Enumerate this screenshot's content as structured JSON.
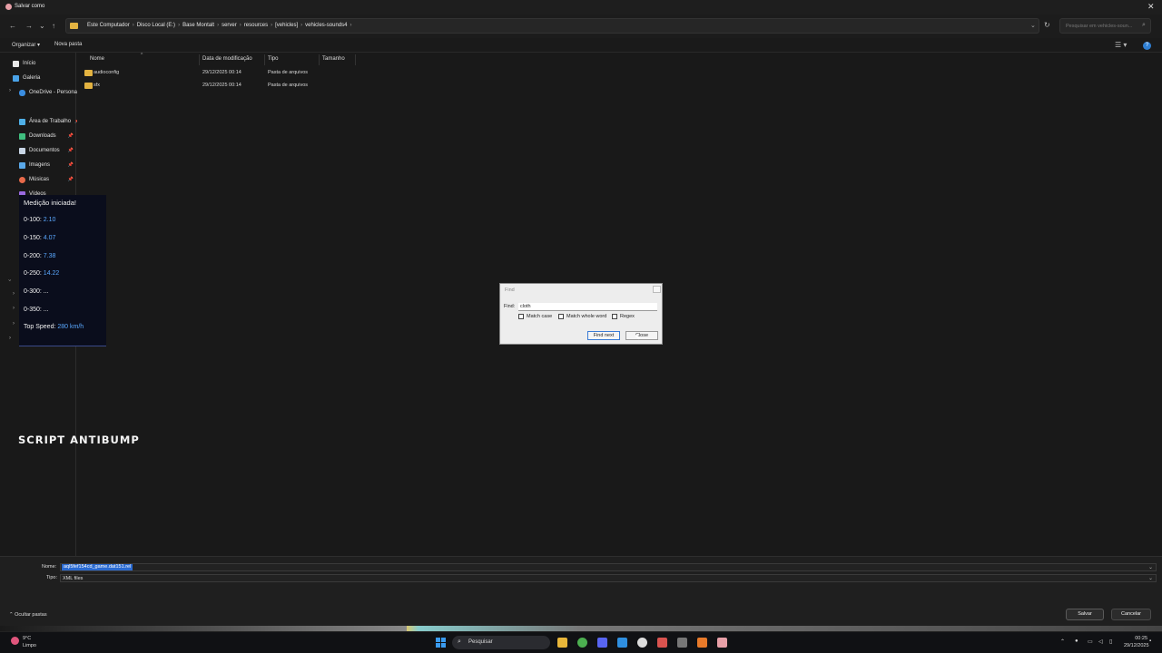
{
  "window": {
    "title": "Salvar como",
    "close_glyph": "✕"
  },
  "nav": {
    "back": "←",
    "forward": "→",
    "recent": "⌄",
    "up": "↑",
    "breadcrumbs": [
      "Este Computador",
      "Disco Local (E:)",
      "Base Montalt",
      "server",
      "resources",
      "[vehicles]",
      "vehicles-sounds4"
    ],
    "separator": "›",
    "refresh": "↻",
    "search_placeholder": "Pesquisar em vehicles-soun...",
    "search_icon": "⌕"
  },
  "commandbar": {
    "organize": "Organizar ▾",
    "new_folder": "Nova pasta",
    "view": "☰ ▾",
    "help": "?"
  },
  "sidebar": {
    "items": [
      {
        "label": "Início",
        "icon": "home-icon",
        "color": "#e8e8e8",
        "pinned": false
      },
      {
        "label": "Galeria",
        "icon": "gallery-icon",
        "color": "#4aa3e8",
        "pinned": false
      },
      {
        "label": "OneDrive - Persona",
        "icon": "cloud-icon",
        "color": "#3a8de0",
        "pinned": false
      },
      {
        "label": "Área de Trabalho",
        "icon": "desktop-icon",
        "color": "#4fb0e8",
        "pinned": true
      },
      {
        "label": "Downloads",
        "icon": "download-icon",
        "color": "#3fbf7f",
        "pinned": true
      },
      {
        "label": "Documentos",
        "icon": "document-icon",
        "color": "#c9d6e6",
        "pinned": true
      },
      {
        "label": "Imagens",
        "icon": "image-icon",
        "color": "#5aa8e8",
        "pinned": true
      },
      {
        "label": "Músicas",
        "icon": "music-icon",
        "color": "#e86a4a",
        "pinned": true
      },
      {
        "label": "Vídeos",
        "icon": "video-icon",
        "color": "#9a6ae0",
        "pinned": false
      }
    ],
    "pin_glyph": "📌",
    "chevron": "›"
  },
  "files": {
    "columns": [
      "Nome",
      "Data de modificação",
      "Tipo",
      "Tamanho"
    ],
    "rows": [
      {
        "name": "audioconfig",
        "date": "29/12/2025 00:14",
        "type": "Pasta de arquivos",
        "size": ""
      },
      {
        "name": "sfx",
        "date": "29/12/2025 00:14",
        "type": "Pasta de arquivos",
        "size": ""
      }
    ]
  },
  "overlay": {
    "header": "Medição iniciada!",
    "lines": [
      {
        "label": "0-100: ",
        "value": "2.10"
      },
      {
        "label": "0-150: ",
        "value": "4.07"
      },
      {
        "label": "0-200: ",
        "value": "7.38"
      },
      {
        "label": "0-250: ",
        "value": "14.22"
      },
      {
        "label": "0-300: ",
        "value": "..."
      },
      {
        "label": "0-350: ",
        "value": "..."
      },
      {
        "label": "Top Speed: ",
        "value": "280 km/h"
      }
    ]
  },
  "script_title": "SCRIPT ANTIBUMP",
  "find_dialog": {
    "title": "Find",
    "find_label": "Find:",
    "find_value": "cloth",
    "options": [
      "Match case",
      "Match whole word",
      "Regex"
    ],
    "find_next": "Find next",
    "close": "Close"
  },
  "bottom": {
    "name_label": "Nome:",
    "name_value": "aql5fef154cd_game.dat151.rel",
    "type_label": "Tipo:",
    "type_value": "XML files",
    "hide_folders": "⌃ Ocultar pastas",
    "save": "Salvar",
    "cancel": "Cancelar"
  },
  "taskbar": {
    "temp": "9°C",
    "weather": "Limpo",
    "search": "Pesquisar",
    "search_icon": "⌕",
    "apps": [
      {
        "name": "windows-start-icon",
        "color": "#3a9bef"
      },
      {
        "name": "file-explorer-icon",
        "color": "#e8b63a"
      },
      {
        "name": "chrome-icon",
        "color": "#4caf50"
      },
      {
        "name": "discord-icon",
        "color": "#5865f2"
      },
      {
        "name": "vscode-icon",
        "color": "#2f8fe0"
      },
      {
        "name": "github-icon",
        "color": "#dddddd"
      },
      {
        "name": "calculator-icon",
        "color": "#d9534f"
      },
      {
        "name": "terminal-icon",
        "color": "#777777"
      },
      {
        "name": "app-a-icon",
        "color": "#e87a2a"
      },
      {
        "name": "app-pink-icon",
        "color": "#e8a0a8"
      }
    ],
    "time": "00:25",
    "date": "29/12/2025"
  },
  "colors": {
    "accent": "#2a6ad1",
    "overlay_value": "#5aa8ff",
    "folder": "#e3b341"
  }
}
